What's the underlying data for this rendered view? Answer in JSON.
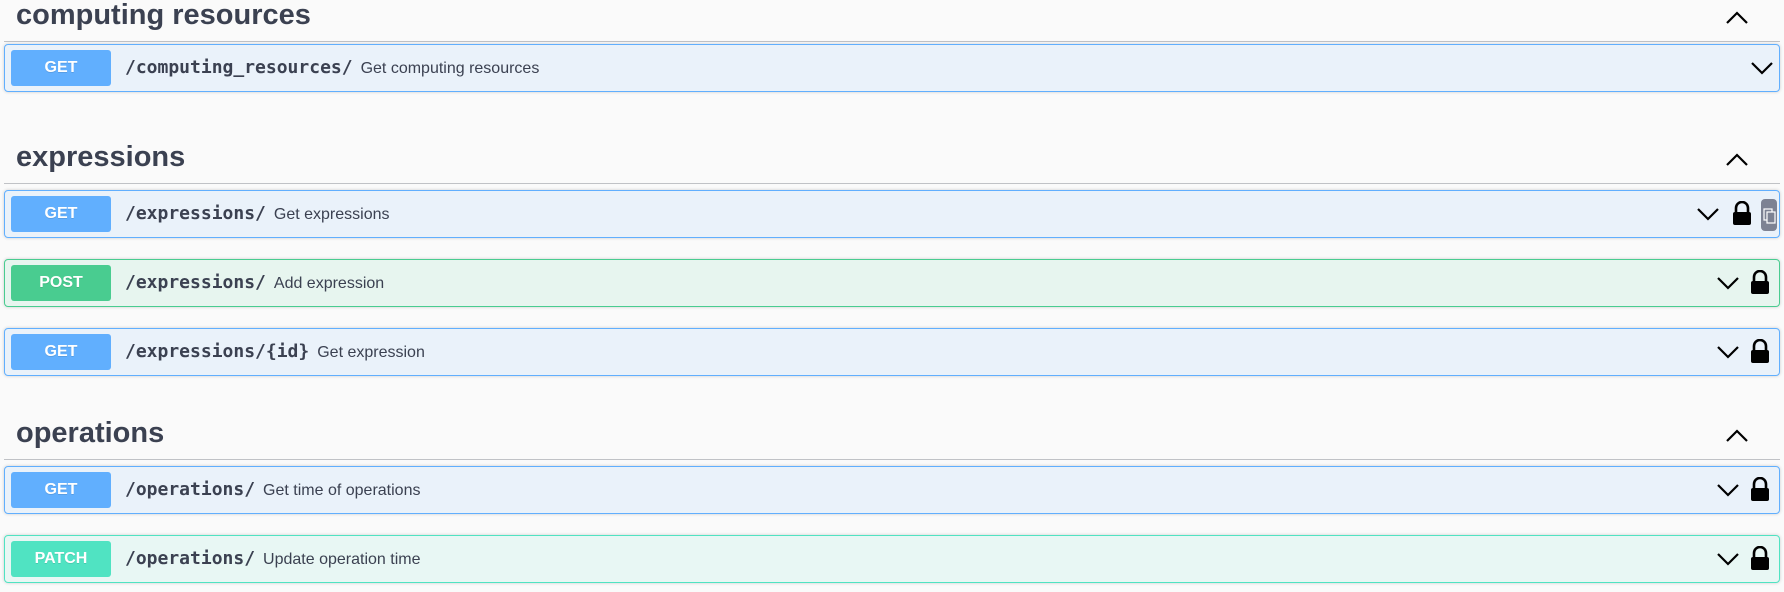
{
  "sections": [
    {
      "title": "computing resources",
      "toggle_icon": "chevron-up-icon",
      "operations": [
        {
          "method": "GET",
          "path": "/computing_resources/",
          "summary": "Get computing resources",
          "locked": false
        }
      ]
    },
    {
      "title": "expressions",
      "toggle_icon": "chevron-up-icon",
      "operations": [
        {
          "method": "GET",
          "path": "/expressions/",
          "summary": "Get expressions",
          "locked": true,
          "copy_button": true
        },
        {
          "method": "POST",
          "path": "/expressions/",
          "summary": "Add expression",
          "locked": true
        },
        {
          "method": "GET",
          "path": "/expressions/{id}",
          "summary": "Get expression",
          "locked": true
        }
      ]
    },
    {
      "title": "operations",
      "toggle_icon": "chevron-up-icon",
      "operations": [
        {
          "method": "GET",
          "path": "/operations/",
          "summary": "Get time of operations",
          "locked": true
        },
        {
          "method": "PATCH",
          "path": "/operations/",
          "summary": "Update operation time",
          "locked": true
        }
      ]
    }
  ],
  "colors": {
    "get": "#61affe",
    "post": "#49cc90",
    "patch": "#50e3c2",
    "text": "#3b4151"
  }
}
